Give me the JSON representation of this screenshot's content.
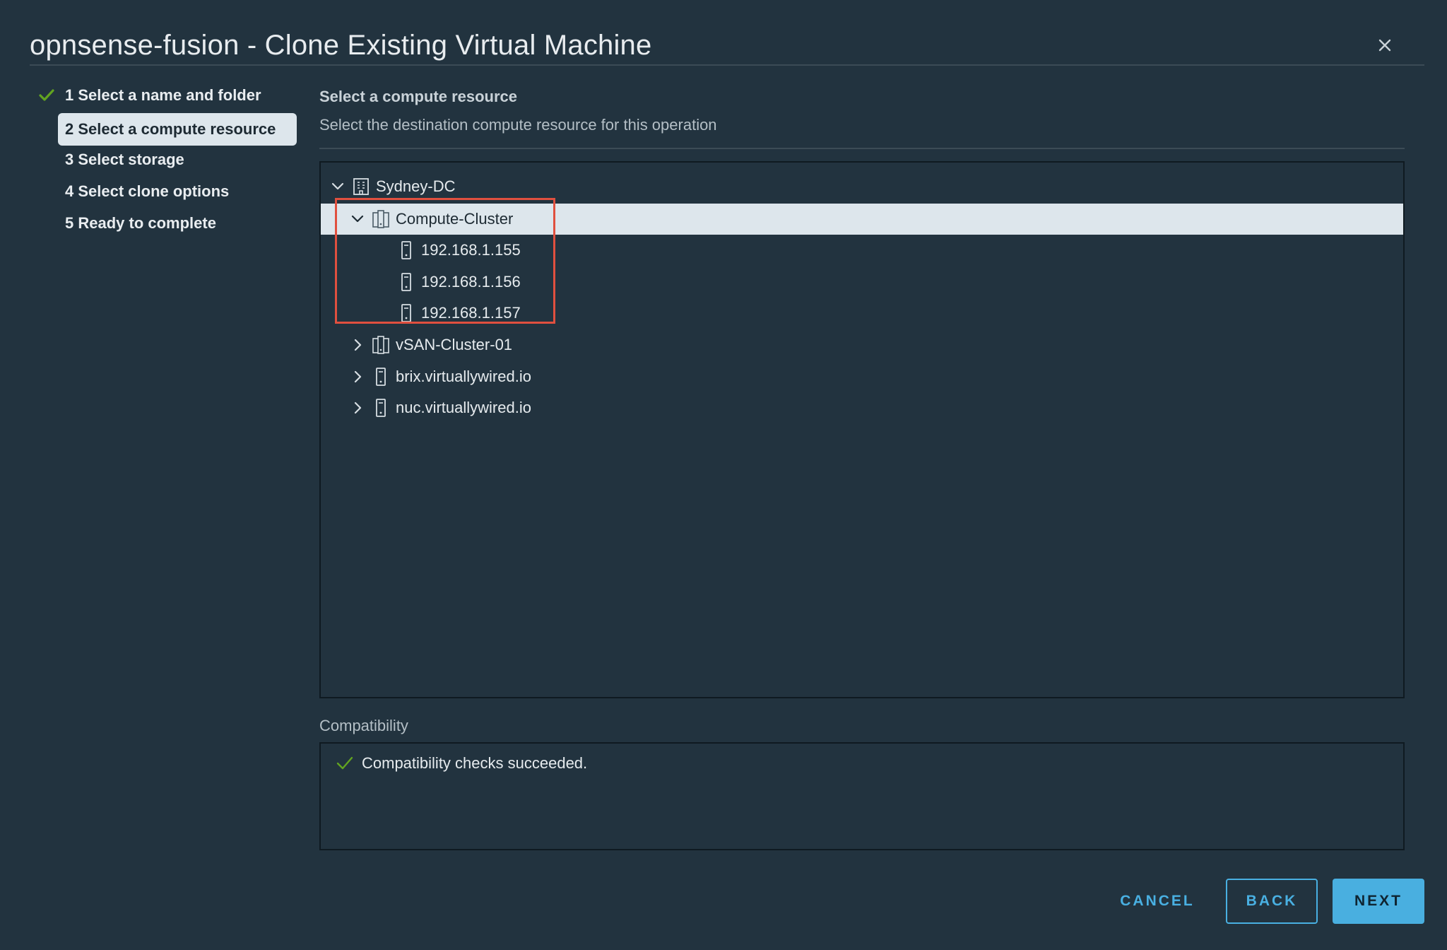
{
  "window": {
    "title": "opnsense-fusion - Clone Existing Virtual Machine"
  },
  "steps": [
    {
      "label": "1 Select a name and folder",
      "status": "completed"
    },
    {
      "label": "2 Select a compute resource",
      "status": "active"
    },
    {
      "label": "3 Select storage",
      "status": "pending"
    },
    {
      "label": "4 Select clone options",
      "status": "pending"
    },
    {
      "label": "5 Ready to complete",
      "status": "pending"
    }
  ],
  "content": {
    "title": "Select a compute resource",
    "subtitle": "Select the destination compute resource for this operation"
  },
  "tree": {
    "datacenter": "Sydney-DC",
    "cluster": "Compute-Cluster",
    "hosts": [
      "192.168.1.155",
      "192.168.1.156",
      "192.168.1.157"
    ],
    "others": [
      "vSAN-Cluster-01",
      "brix.virtuallywired.io",
      "nuc.virtuallywired.io"
    ]
  },
  "compatibility": {
    "label": "Compatibility",
    "message": "Compatibility checks succeeded."
  },
  "buttons": {
    "cancel": "CANCEL",
    "back": "BACK",
    "next": "NEXT"
  },
  "colors": {
    "background": "#22333f",
    "accent": "#49afe0",
    "selected_row": "#dde6ec",
    "success": "#62a420",
    "highlight_box": "#e0503f"
  }
}
